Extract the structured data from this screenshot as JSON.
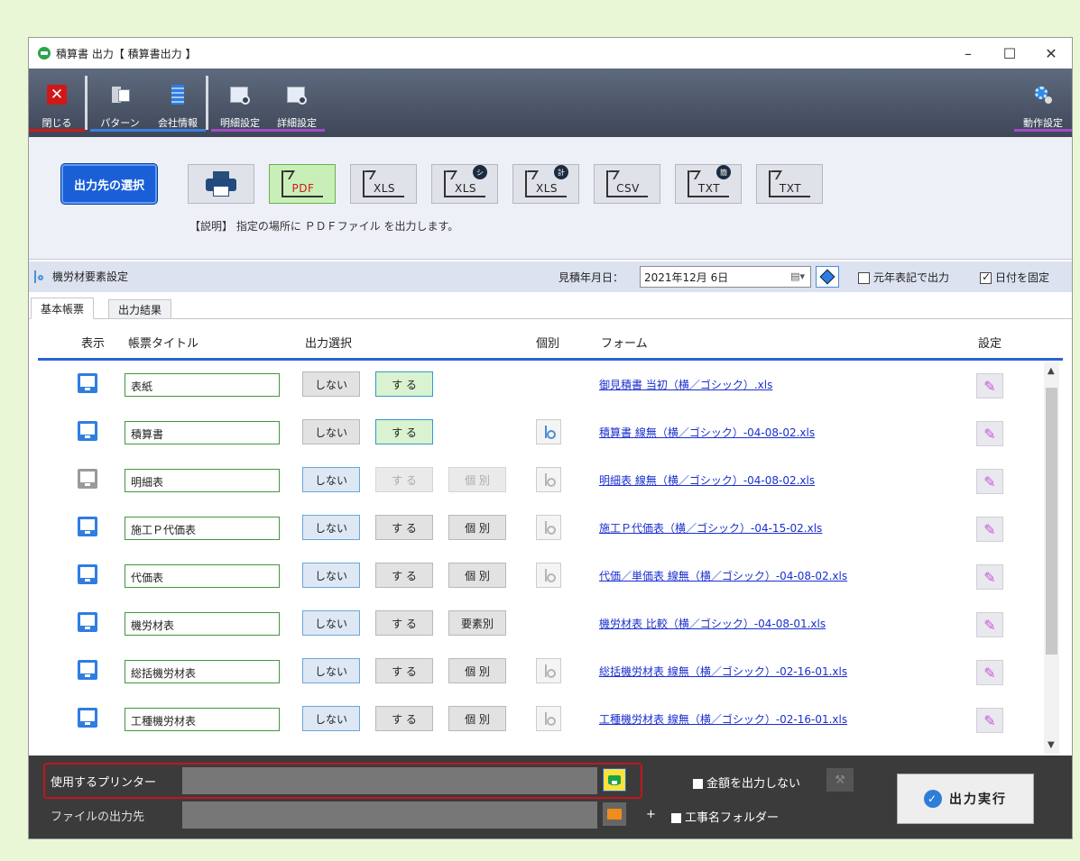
{
  "window": {
    "title": "積算書 出力【 積算書出力 】"
  },
  "toolbar": {
    "close": "閉じる",
    "pattern": "パターン",
    "company": "会社情報",
    "detail_settings": "明細設定",
    "detail_settings2": "詳細設定",
    "action_settings": "動作設定"
  },
  "output": {
    "select_dest": "出力先の選択",
    "formats": [
      {
        "ext": "",
        "icon": "printer-icon"
      },
      {
        "ext": "PDF",
        "badge": ""
      },
      {
        "ext": "XLS",
        "badge": ""
      },
      {
        "ext": "XLS",
        "badge": "シ"
      },
      {
        "ext": "XLS",
        "badge": "計"
      },
      {
        "ext": "CSV",
        "badge": ""
      },
      {
        "ext": "TXT",
        "badge": "簡"
      },
      {
        "ext": "TXT",
        "badge": ""
      }
    ],
    "description": "【説明】 指定の場所に ＰＤＦファイル を出力します。"
  },
  "settings": {
    "material_settings": "機労材要素設定",
    "estimate_date_label": "見積年月日：",
    "estimate_date": "2021年12月 6日",
    "gengo_label": "元年表記で出力",
    "fix_date_label": "日付を固定"
  },
  "tabs": [
    "基本帳票",
    "出力結果"
  ],
  "grid": {
    "headers": {
      "show": "表示",
      "title": "帳票タイトル",
      "select": "出力選択",
      "individual": "個別",
      "form": "フォーム",
      "setting": "設定"
    },
    "rows": [
      {
        "title": "表紙",
        "no": "しない",
        "yes": "す る",
        "extra": "",
        "tree": "none",
        "form": "御見積書 当初（横／ゴシック）.xls"
      },
      {
        "title": "積算書",
        "no": "しない",
        "yes": "す る",
        "extra": "",
        "tree": "active",
        "form": "積算書 線無（横／ゴシック）-04-08-02.xls"
      },
      {
        "title": "明細表",
        "no": "しない",
        "yes": "す る",
        "extra": "個 別",
        "tree": "dim",
        "form": "明細表 線無（横／ゴシック）-04-08-02.xls"
      },
      {
        "title": "施工Ｐ代価表",
        "no": "しない",
        "yes": "す る",
        "extra": "個 別",
        "tree": "dim",
        "form": "施工Ｐ代価表（横／ゴシック）-04-15-02.xls"
      },
      {
        "title": "代価表",
        "no": "しない",
        "yes": "す る",
        "extra": "個 別",
        "tree": "dim",
        "form": "代価／単価表 線無（横／ゴシック）-04-08-02.xls"
      },
      {
        "title": "機労材表",
        "no": "しない",
        "yes": "す る",
        "extra": "要素別",
        "tree": "none",
        "form": "機労材表 比較（横／ゴシック）-04-08-01.xls"
      },
      {
        "title": "総括機労材表",
        "no": "しない",
        "yes": "す る",
        "extra": "個 別",
        "tree": "dim",
        "form": "総括機労材表 線無（横／ゴシック）-02-16-01.xls"
      },
      {
        "title": "工種機労材表",
        "no": "しない",
        "yes": "す る",
        "extra": "個 別",
        "tree": "dim",
        "form": "工種機労材表 線無（横／ゴシック）-02-16-01.xls"
      }
    ]
  },
  "bottom": {
    "printer_label": "使用するプリンター",
    "file_dest_label": "ファイルの出力先",
    "no_amount_label": "金額を出力しない",
    "plus": "+",
    "project_folder_label": "工事名フォルダー",
    "execute": "出力実行"
  }
}
